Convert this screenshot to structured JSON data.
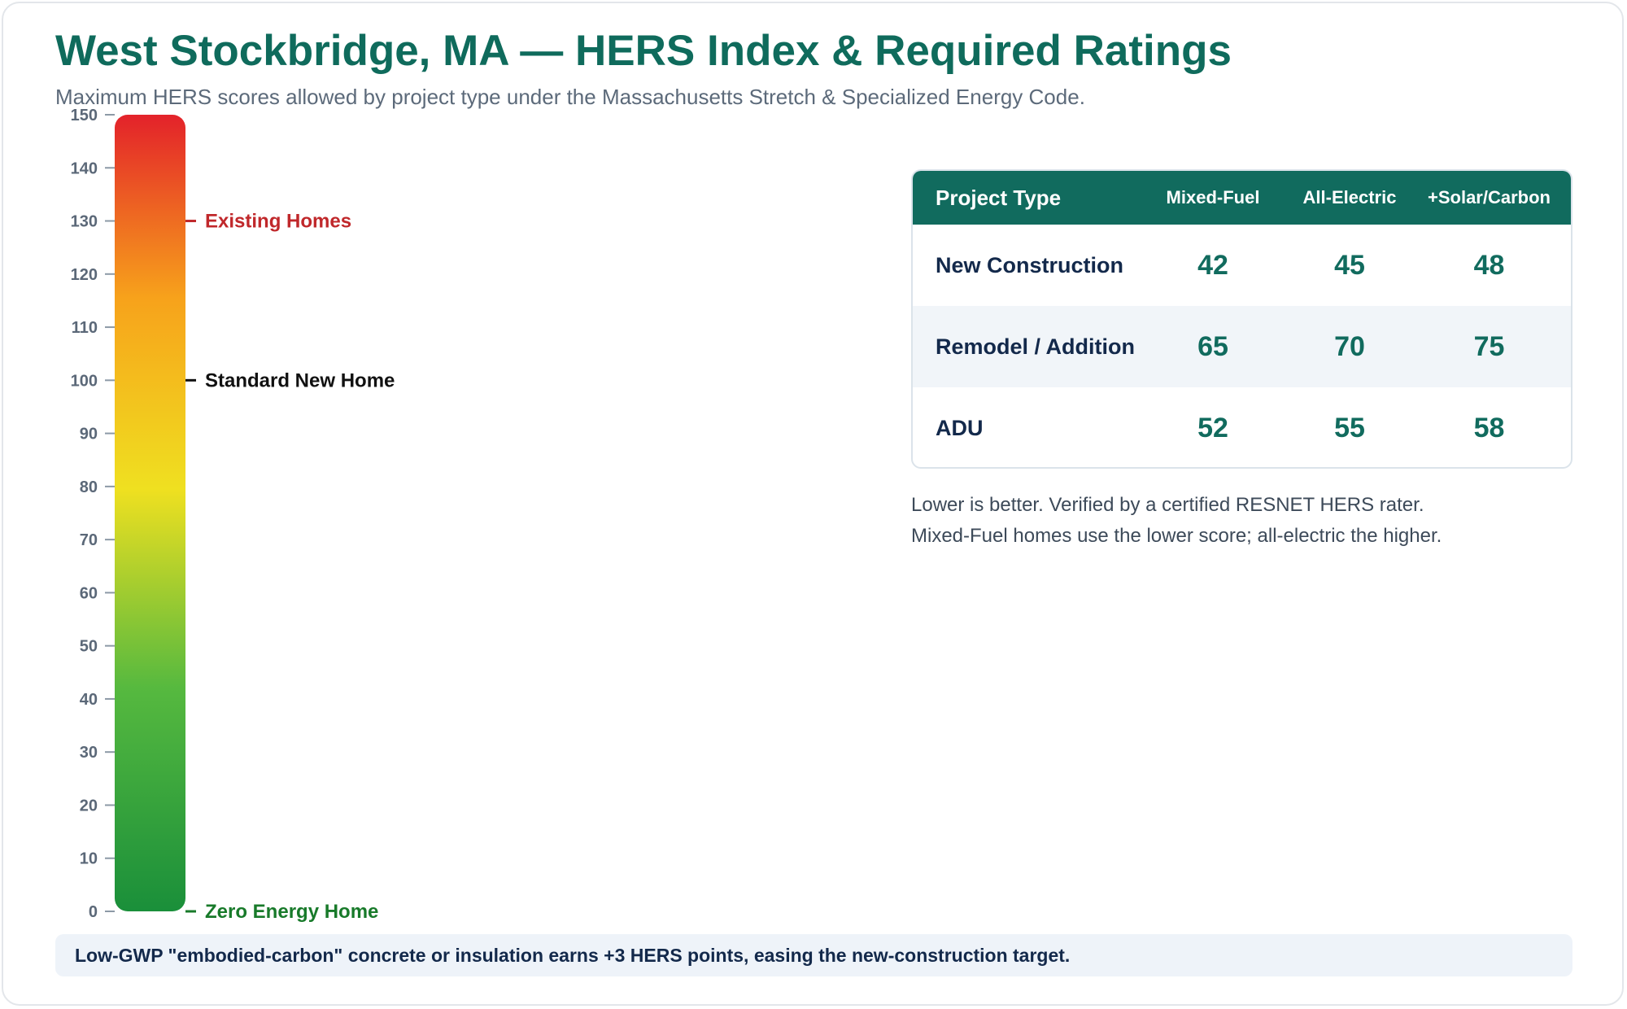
{
  "header": {
    "title": "West Stockbridge, MA — HERS Index & Required Ratings",
    "subtitle": "Maximum HERS scores allowed by project type under the Massachusetts Stretch & Specialized Energy Code."
  },
  "chart_data": [
    {
      "type": "gauge",
      "axis": {
        "min": 0,
        "max": 150,
        "ticks": [
          0,
          10,
          20,
          30,
          40,
          50,
          60,
          70,
          80,
          90,
          100,
          110,
          120,
          130,
          140,
          150
        ]
      },
      "colors": {
        "low": "#1a8f3a",
        "mid_low": "#56b93f",
        "mid": "#efe020",
        "mid_high": "#f7a21b",
        "high": "#e3222a"
      },
      "markers": [
        {
          "label": "Existing Homes",
          "value": 130,
          "color": "#c0282b"
        },
        {
          "label": "Standard New Home",
          "value": 100,
          "color": "#111111"
        },
        {
          "label": "Zero Energy Home",
          "value": 0,
          "color": "#187a2a"
        }
      ]
    },
    {
      "type": "table",
      "columns": [
        "Project Type",
        "Mixed-Fuel",
        "All-Electric",
        "+Solar/Carbon"
      ],
      "rows": [
        {
          "label": "New Construction",
          "values": [
            42,
            45,
            48
          ]
        },
        {
          "label": "Remodel / Addition",
          "values": [
            65,
            70,
            75
          ]
        },
        {
          "label": "ADU",
          "values": [
            52,
            55,
            58
          ]
        }
      ]
    }
  ],
  "notes": {
    "line1": "Lower is better. Verified by a certified RESNET HERS rater.",
    "line2": "Mixed-Fuel homes use the lower score; all-electric the higher."
  },
  "footnote": "Low-GWP \"embodied-carbon\" concrete or insulation earns +3 HERS points, easing the new-construction target."
}
